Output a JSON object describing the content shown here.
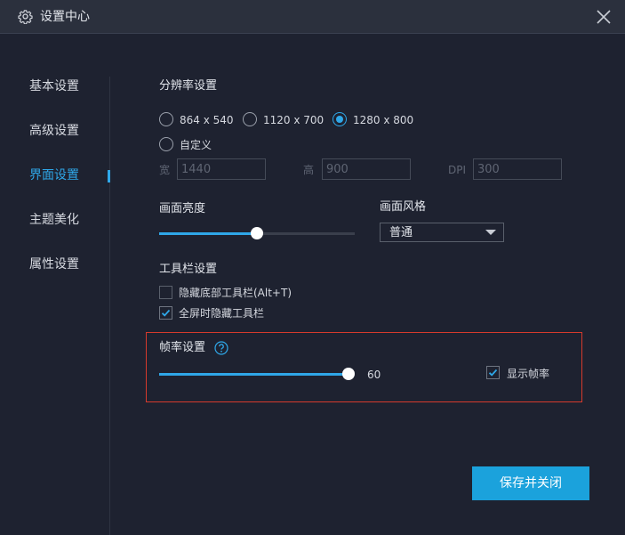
{
  "window": {
    "title": "设置中心",
    "icon": "gear-icon",
    "close_icon": "close-icon"
  },
  "sidebar": {
    "items": [
      {
        "label": "基本设置",
        "active": false
      },
      {
        "label": "高级设置",
        "active": false
      },
      {
        "label": "界面设置",
        "active": true
      },
      {
        "label": "主题美化",
        "active": false
      },
      {
        "label": "属性设置",
        "active": false
      }
    ]
  },
  "resolution": {
    "title": "分辨率设置",
    "options": [
      {
        "label": "864 x 540",
        "checked": false
      },
      {
        "label": "1120 x 700",
        "checked": false
      },
      {
        "label": "1280 x 800",
        "checked": true
      },
      {
        "label": "自定义",
        "checked": false
      }
    ],
    "custom": {
      "width_label": "宽",
      "width_value": "1440",
      "height_label": "高",
      "height_value": "900",
      "dpi_label": "DPI",
      "dpi_value": "300"
    }
  },
  "brightness": {
    "title": "画面亮度",
    "level_percent": 50
  },
  "style": {
    "title": "画面风格",
    "selected": "普通"
  },
  "toolbar": {
    "title": "工具栏设置",
    "options": [
      {
        "label": "隐藏底部工具栏(Alt+T)",
        "checked": false
      },
      {
        "label": "全屏时隐藏工具栏",
        "checked": true
      }
    ]
  },
  "fps": {
    "title": "帧率设置",
    "help_icon": "question-circle-icon",
    "value": "60",
    "level_percent": 100,
    "show_fps_label": "显示帧率",
    "show_fps_checked": true
  },
  "actions": {
    "save_close_label": "保存并关闭"
  },
  "colors": {
    "background": "#1e2230",
    "titlebar": "#2b303d",
    "accent": "#2fa7e8",
    "button": "#1ba2dc",
    "highlight_border": "#d63a2c"
  }
}
